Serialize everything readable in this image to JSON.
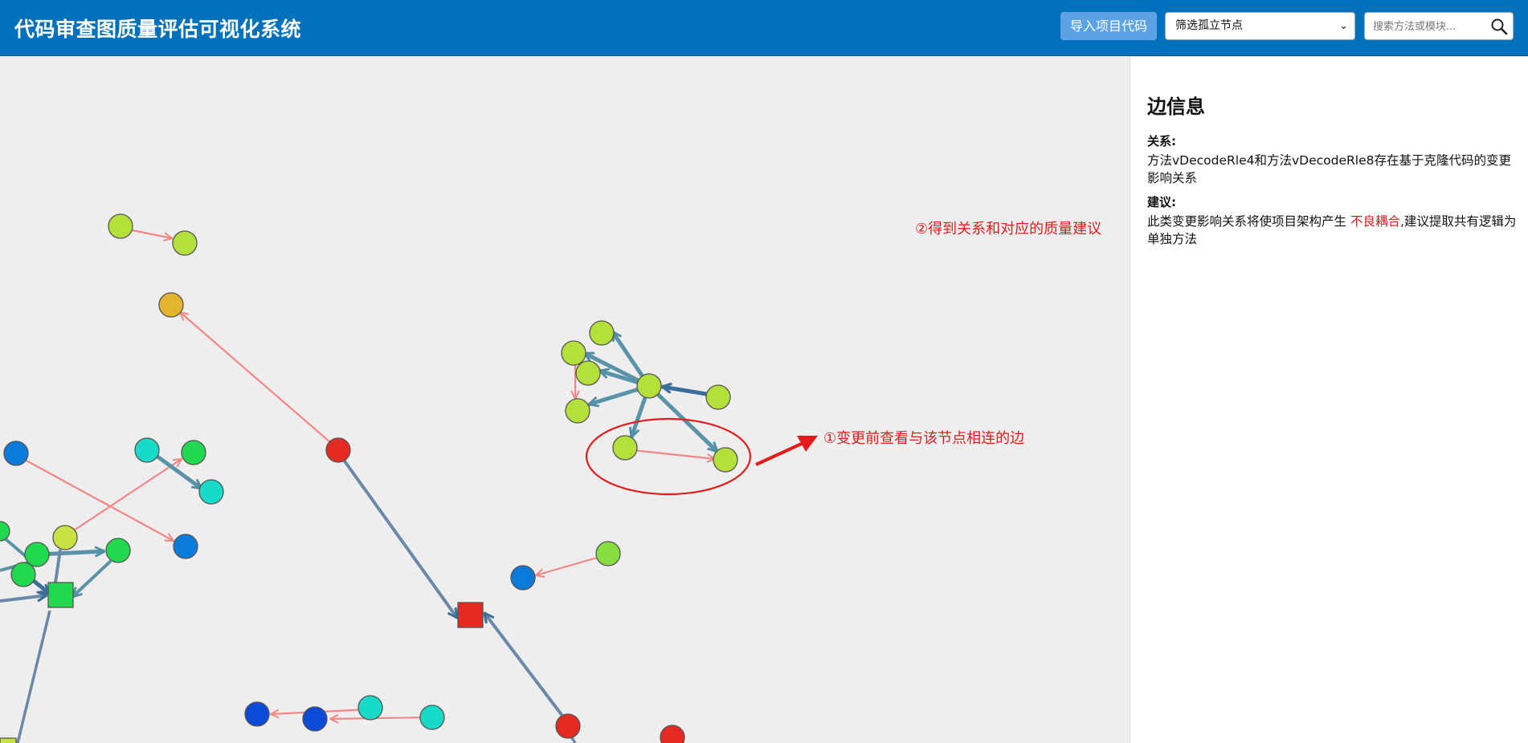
{
  "header": {
    "title": "代码审查图质量评估可视化系统",
    "import_button": "导入项目代码",
    "filter_select": {
      "selected": "筛选孤立节点"
    },
    "search": {
      "placeholder": "搜索方法或模块..."
    },
    "background": "#0171bb"
  },
  "panel": {
    "title": "边信息",
    "relation_label": "关系:",
    "relation_text": "方法vDecodeRle4和方法vDecodeRle8存在基于克隆代码的变更影响关系",
    "suggestion_label": "建议:",
    "suggestion_prefix": "此类变更影响关系将使项目架构产生",
    "suggestion_highlight": "不良耦合",
    "suggestion_suffix": ",建议提取共有逻辑为单独方法"
  },
  "annotations": {
    "step1": "①变更前查看与该节点相连的边",
    "step2": "②得到关系和对应的质量建议"
  },
  "colors": {
    "clone_edge": "#f58686",
    "dep_edge": "#5a93a8",
    "call_edge": "#6b88a8",
    "annotation": "#e21c1c",
    "node_yellow_green": "#b4e03c",
    "node_green": "#22d84e",
    "node_cyan": "#17dbc8",
    "node_blue": "#0b7ad8",
    "node_dark_blue": "#0b4bd8",
    "node_red": "#e42a22",
    "node_orange": "#e3b52e"
  }
}
